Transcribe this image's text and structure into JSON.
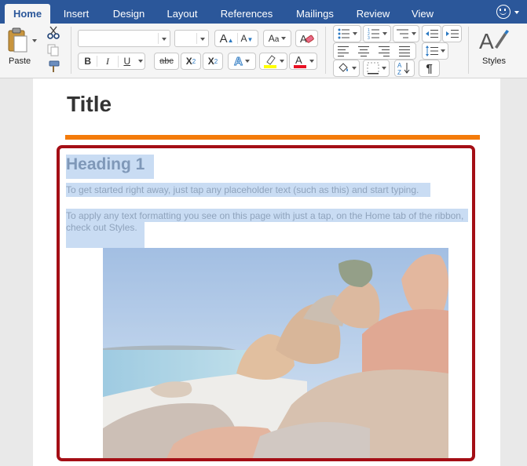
{
  "tabs": [
    "Home",
    "Insert",
    "Design",
    "Layout",
    "References",
    "Mailings",
    "Review",
    "View"
  ],
  "active_tab": "Home",
  "clipboard": {
    "paste_label": "Paste"
  },
  "font": {
    "name_value": "",
    "size_value": ""
  },
  "styles": {
    "label": "Styles"
  },
  "format_buttons": {
    "bold": "B",
    "italic": "I",
    "underline": "U",
    "strikethrough": "abc",
    "subscript_base": "X",
    "subscript_mark": "2",
    "superscript_base": "X",
    "superscript_mark": "2"
  },
  "document": {
    "title": "Title",
    "heading1": "Heading 1",
    "paragraph1": "To get started right away, just tap any placeholder text (such as this) and start typing.",
    "paragraph2": "To apply any text formatting you see on this page with just a tap, on the Home tab of the ribbon, check out Styles."
  },
  "colors": {
    "tab_bar": "#2b579a",
    "title_rule": "#f47b0a",
    "selection": "#c9dcf3",
    "highlight_frame": "#a40e15",
    "highlighter_yellow": "#ffff00",
    "font_color_red": "#e81123"
  }
}
